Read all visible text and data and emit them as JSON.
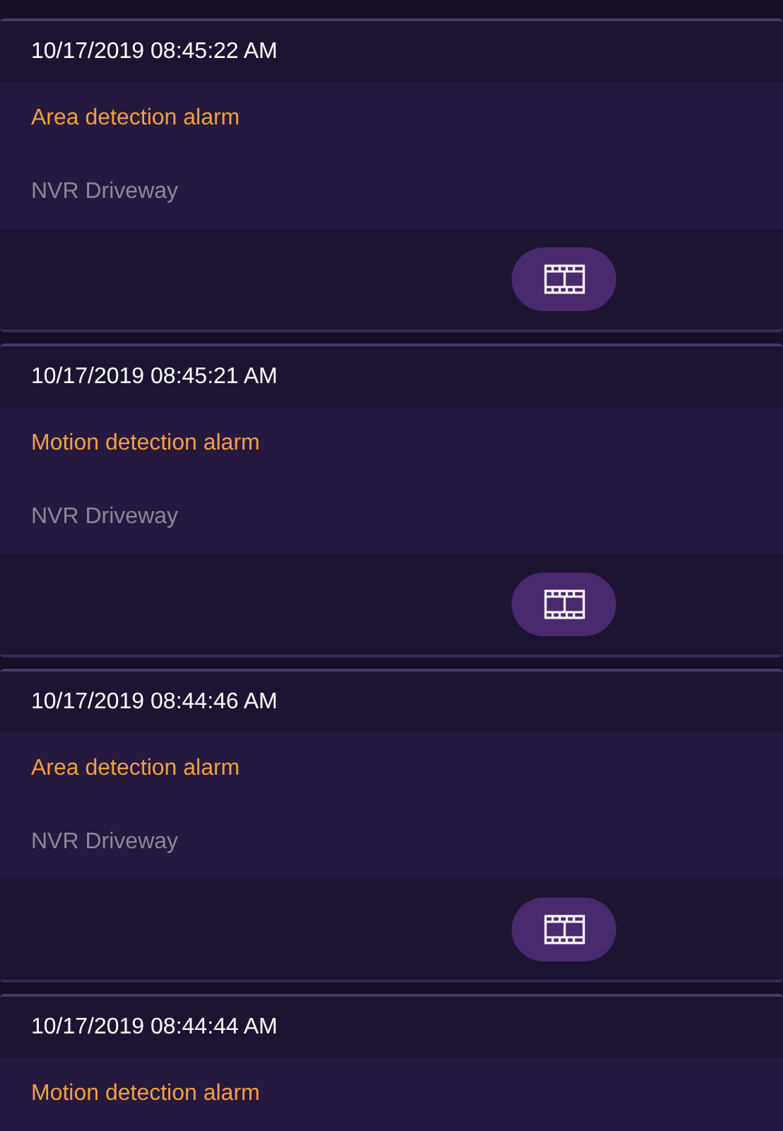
{
  "events": [
    {
      "time": "10/17/2019 08:45:22 AM",
      "alarm": "Area detection alarm",
      "source": "NVR Driveway",
      "has_video": true
    },
    {
      "time": "10/17/2019 08:45:21 AM",
      "alarm": "Motion detection alarm",
      "source": "NVR Driveway",
      "has_video": true
    },
    {
      "time": "10/17/2019 08:44:46 AM",
      "alarm": "Area detection alarm",
      "source": "NVR Driveway",
      "has_video": true
    },
    {
      "time": "10/17/2019 08:44:44 AM",
      "alarm": "Motion detection alarm"
    }
  ]
}
